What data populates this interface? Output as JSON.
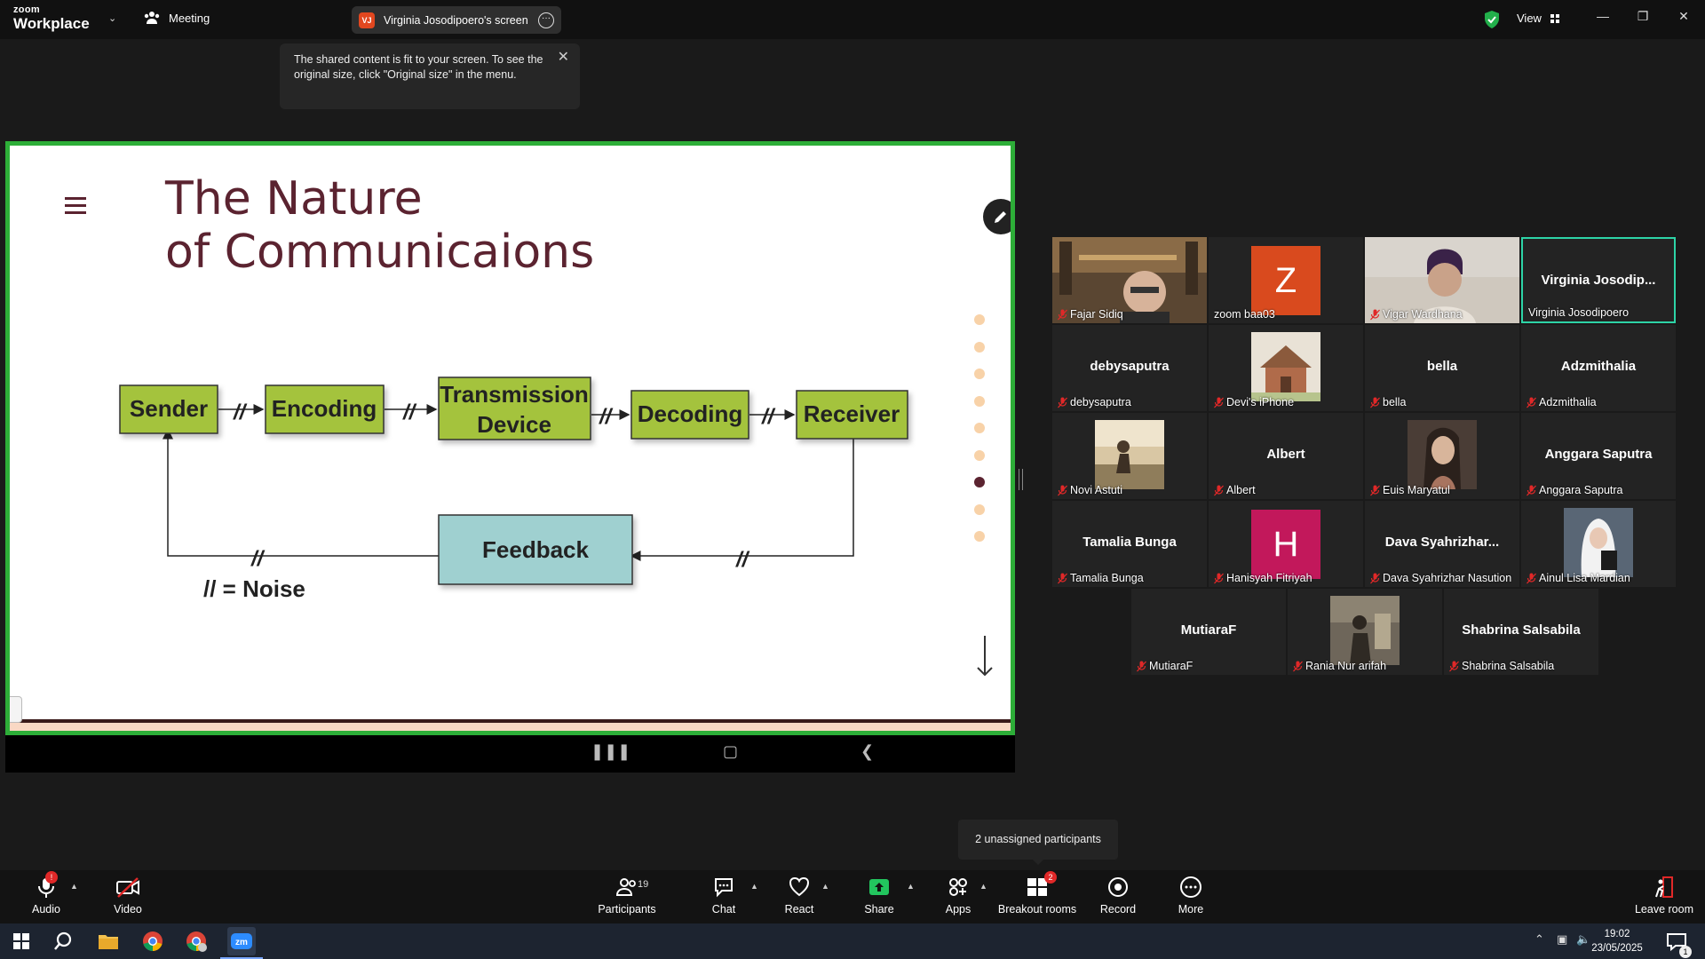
{
  "app": {
    "logo_top": "zoom",
    "logo_bottom": "Workplace",
    "meeting_label": "Meeting",
    "share_initials": "VJ",
    "share_title": "Virginia Josodipoero's screen",
    "view_label": "View"
  },
  "tooltip": {
    "text": "The shared content is fit to your screen. To see the original size, click \"Original size\" in the menu."
  },
  "slide": {
    "title": "The Nature\nof Communicaions",
    "nodes": [
      "Sender",
      "Encoding",
      "Transmission",
      "Device",
      "Decoding",
      "Receiver",
      "Feedback"
    ],
    "noise_mark": "//",
    "legend": "// = Noise",
    "nav_dots": 9,
    "active_dot": 6
  },
  "participants": [
    {
      "label": "Fajar Sidiq",
      "display": "",
      "type": "video",
      "muted": true
    },
    {
      "label": "zoom baa03",
      "display": "Z",
      "type": "avatar",
      "color": "#d94a1e",
      "muted": false
    },
    {
      "label": "Vigar Wardhana",
      "display": "",
      "type": "video",
      "muted": true
    },
    {
      "label": "Virginia Josodipoero",
      "display": "Virginia  Josodip...",
      "type": "name",
      "muted": false,
      "speaker": true
    },
    {
      "label": "debysaputra",
      "display": "debysaputra",
      "type": "name",
      "muted": true
    },
    {
      "label": "Devi's iPhone",
      "display": "",
      "type": "photo",
      "muted": true
    },
    {
      "label": "bella",
      "display": "bella",
      "type": "name",
      "muted": true
    },
    {
      "label": "Adzmithalia",
      "display": "Adzmithalia",
      "type": "name",
      "muted": true
    },
    {
      "label": "Novi Astuti",
      "display": "",
      "type": "photo",
      "muted": true
    },
    {
      "label": "Albert",
      "display": "Albert",
      "type": "name",
      "muted": true
    },
    {
      "label": "Euis Maryatul",
      "display": "",
      "type": "photo",
      "muted": true
    },
    {
      "label": "Anggara Saputra",
      "display": "Anggara Saputra",
      "type": "name",
      "muted": true
    },
    {
      "label": "Tamalia Bunga",
      "display": "Tamalia Bunga",
      "type": "name",
      "muted": true
    },
    {
      "label": "Hanisyah Fitriyah",
      "display": "H",
      "type": "avatar",
      "color": "#c2185b",
      "muted": true
    },
    {
      "label": "Dava Syahrizhar Nasution",
      "display": "Dava  Syahrizhar...",
      "type": "name",
      "muted": true
    },
    {
      "label": "Ainul Lisa Mardian",
      "display": "",
      "type": "photo",
      "muted": true
    },
    {
      "label": "MutiaraF",
      "display": "MutiaraF",
      "type": "name",
      "muted": true
    },
    {
      "label": "Rania Nur arifah",
      "display": "",
      "type": "photo",
      "muted": true
    },
    {
      "label": "Shabrina Salsabila",
      "display": "Shabrina Salsabila",
      "type": "name",
      "muted": true
    }
  ],
  "breakout_tooltip": "2 unassigned participants",
  "toolbar": {
    "audio": "Audio",
    "video": "Video",
    "participants": "Participants",
    "participants_count": "19",
    "chat": "Chat",
    "react": "React",
    "share": "Share",
    "apps": "Apps",
    "breakout": "Breakout rooms",
    "breakout_badge": "2",
    "record": "Record",
    "more": "More",
    "leave": "Leave room"
  },
  "taskbar": {
    "time": "19:02",
    "date": "23/05/2025",
    "notification_count": "1"
  },
  "colors": {
    "active_speaker": "#2dd4a7",
    "share_border": "#2dae38",
    "node_green": "#a4c33c",
    "node_feedback": "#9fd0d0",
    "title_maroon": "#5b2330",
    "mute_red": "#e02828"
  }
}
